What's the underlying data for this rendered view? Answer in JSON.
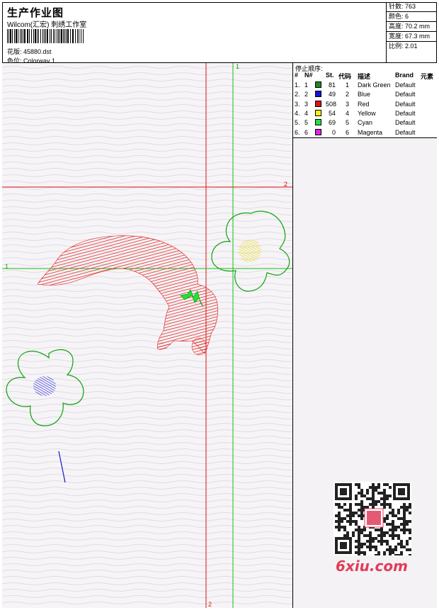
{
  "header": {
    "title": "生产作业图",
    "subtitle": "Wilcom(汇宏) 刺绣工作室",
    "design_label": "花版: 45880.dst",
    "colorway_label": "色位: Colorway 1"
  },
  "stats": [
    {
      "label": "针数: 763"
    },
    {
      "label": "颜色: 6"
    },
    {
      "label": "高度: 70.2 mm"
    },
    {
      "label": "宽度: 67.3 mm"
    },
    {
      "label": "比例: 2.01"
    }
  ],
  "stop_sequence": {
    "title": "停止顺序:",
    "headers": {
      "idx": "#",
      "n": "N#",
      "st": "St.",
      "code": "代码",
      "desc": "描述",
      "brand": "Brand",
      "elem": "元素"
    },
    "rows": [
      {
        "idx": "1.",
        "n": "1",
        "color": "#1f8a1f",
        "st": "81",
        "code": "1",
        "desc": "Dark Green",
        "brand": "Default"
      },
      {
        "idx": "2.",
        "n": "2",
        "color": "#1414d8",
        "st": "49",
        "code": "2",
        "desc": "Blue",
        "brand": "Default"
      },
      {
        "idx": "3.",
        "n": "3",
        "color": "#e41010",
        "st": "508",
        "code": "3",
        "desc": "Red",
        "brand": "Default"
      },
      {
        "idx": "4.",
        "n": "4",
        "color": "#f6f018",
        "st": "54",
        "code": "4",
        "desc": "Yellow",
        "brand": "Default"
      },
      {
        "idx": "5.",
        "n": "5",
        "color": "#22e040",
        "st": "69",
        "code": "5",
        "desc": "Cyan",
        "brand": "Default"
      },
      {
        "idx": "6.",
        "n": "6",
        "color": "#e020e0",
        "st": "0",
        "code": "6",
        "desc": "Magenta",
        "brand": "Default"
      }
    ]
  },
  "guides": {
    "green_label_top": "1",
    "green_label_left": "1",
    "red_label_right": "2",
    "red_label_bottom": "2"
  },
  "watermark": {
    "text": "6xiu.com",
    "seal": "图网"
  },
  "colors": {
    "guide_red": "#e01010",
    "guide_green": "#10c010",
    "outline_green": "#10a010"
  }
}
